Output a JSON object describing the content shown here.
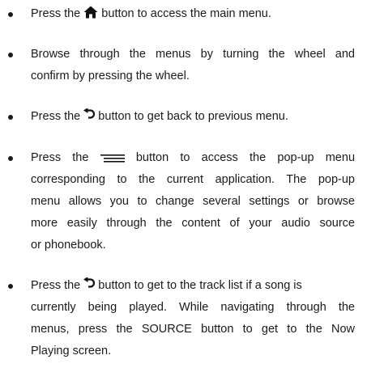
{
  "items": [
    {
      "lines": [
        {
          "pre": "Press the ",
          "icon": "home-icon",
          "post": " button to access the main menu."
        }
      ]
    },
    {
      "lines": [
        {
          "text": "Browse through the menus by turning the wheel and"
        },
        {
          "text": "confirm by pressing the wheel."
        }
      ]
    },
    {
      "lines": [
        {
          "pre": "Press the ",
          "icon": "back-arrow-icon",
          "post": " button to get back to previous menu."
        }
      ]
    },
    {
      "lines": [
        {
          "pre": "Press the ",
          "icon": "menu-lines-icon",
          "post": " button to access the pop-up menu"
        },
        {
          "text": "corresponding to the current application. The pop-up"
        },
        {
          "text": "menu allows you to change several settings or browse"
        },
        {
          "text": "more easily through the content of your audio source"
        },
        {
          "text": "or phonebook."
        }
      ]
    },
    {
      "lines": [
        {
          "pre": "Press the ",
          "icon": "back-arrow-icon",
          "post": " button to get to the track list if a song is"
        },
        {
          "text": "currently being played. While navigating through the"
        },
        {
          "text": "menus, press the SOURCE button to get to the Now"
        },
        {
          "text": "Playing screen."
        }
      ]
    }
  ]
}
